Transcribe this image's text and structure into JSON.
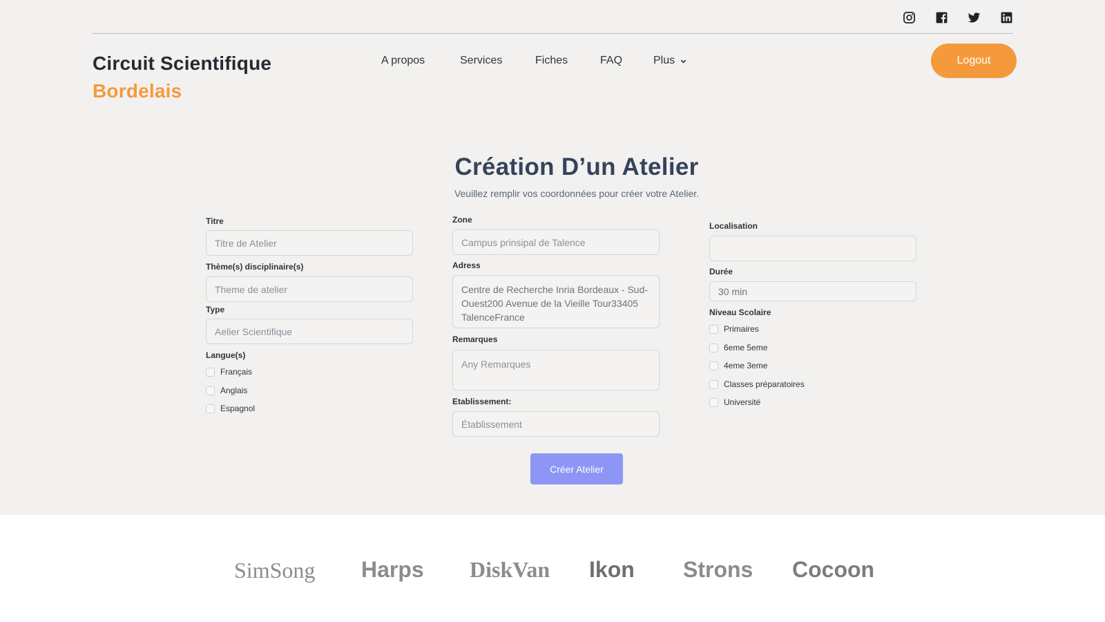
{
  "header": {
    "social_icons": [
      "instagram-icon",
      "facebook-icon",
      "twitter-icon",
      "linkedin-icon"
    ],
    "brand_line1": "Circuit Scientifique",
    "brand_line2": "Bordelais",
    "nav": [
      "A propos",
      "Services",
      "Fiches",
      "FAQ",
      "Plus"
    ],
    "logout_label": "Logout"
  },
  "form": {
    "title": "Création  D’un Atelier",
    "subtitle": "Veuillez remplir vos coordonnées pour créer votre Atelier.",
    "titre_label": "Titre",
    "titre_placeholder": "Titre de Atelier",
    "theme_label": "Thème(s) disciplinaire(s)",
    "theme_placeholder": "Theme de atelier",
    "type_label": "Type",
    "type_placeholder": "Aelier Scientifique",
    "langue_label": "Langue(s)",
    "langues": [
      "Français",
      "Anglais",
      "Espagnol"
    ],
    "zone_label": "Zone",
    "zone_placeholder": "Campus prinsipal de Talence",
    "adress_label": "Adress",
    "adress_value": "Centre de Recherche Inria Bordeaux - Sud-Ouest200 Avenue de la Vieille Tour33405 TalenceFrance",
    "remarques_label": "Remarques",
    "remarques_placeholder": "Any Remarques",
    "etab_label": "Etablissement:",
    "etab_placeholder": "Établissement",
    "localisation_label": "Localisation",
    "localisation_value": "",
    "duree_label": "Durée",
    "duree_value": "30 min",
    "niveau_label": "Niveau Scolaire",
    "niveaux": [
      "Primaires",
      "6eme 5eme",
      "4eme 3eme",
      "Classes préparatoires",
      "Université"
    ],
    "submit_label": "Créer  Atelier"
  },
  "footer": {
    "logos": [
      "SimSong",
      "Harps",
      "DiskVan",
      "Ikon",
      "Strons",
      "Cocoon"
    ]
  },
  "colors": {
    "accent": "#f59a3c",
    "button": "#8d96f5",
    "title": "#36435a"
  }
}
